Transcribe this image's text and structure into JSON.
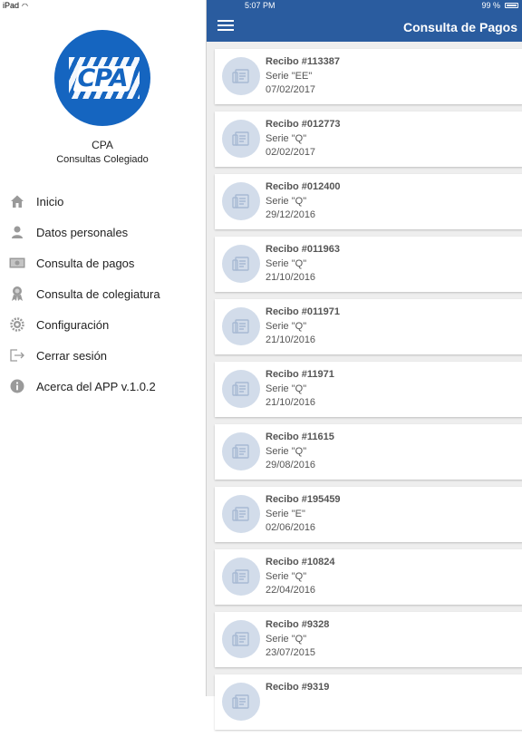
{
  "status": {
    "device": "iPad",
    "time": "5:07 PM",
    "battery": "99 %"
  },
  "sidebar": {
    "org_name": "CPA",
    "org_subtitle": "Consultas Colegiado",
    "logo_text": "CPA",
    "items": [
      {
        "label": "Inicio",
        "icon": "home-icon"
      },
      {
        "label": "Datos personales",
        "icon": "user-icon"
      },
      {
        "label": "Consulta de pagos",
        "icon": "money-icon"
      },
      {
        "label": "Consulta de colegiatura",
        "icon": "award-icon"
      },
      {
        "label": "Configuración",
        "icon": "gear-icon"
      },
      {
        "label": "Cerrar sesión",
        "icon": "logout-icon"
      },
      {
        "label": "Acerca del APP v.1.0.2",
        "icon": "info-icon"
      }
    ]
  },
  "header": {
    "title": "Consulta de Pagos"
  },
  "receipts": [
    {
      "title": "Recibo #113387",
      "serie": "Serie \"EE\"",
      "date": "07/02/2017"
    },
    {
      "title": "Recibo #012773",
      "serie": "Serie \"Q\"",
      "date": "02/02/2017"
    },
    {
      "title": "Recibo #012400",
      "serie": "Serie \"Q\"",
      "date": "29/12/2016"
    },
    {
      "title": "Recibo #011963",
      "serie": "Serie \"Q\"",
      "date": "21/10/2016"
    },
    {
      "title": "Recibo #011971",
      "serie": "Serie \"Q\"",
      "date": "21/10/2016"
    },
    {
      "title": "Recibo #11971",
      "serie": "Serie \"Q\"",
      "date": "21/10/2016"
    },
    {
      "title": "Recibo #11615",
      "serie": "Serie \"Q\"",
      "date": "29/08/2016"
    },
    {
      "title": "Recibo #195459",
      "serie": "Serie \"E\"",
      "date": "02/06/2016"
    },
    {
      "title": "Recibo #10824",
      "serie": "Serie \"Q\"",
      "date": "22/04/2016"
    },
    {
      "title": "Recibo #9328",
      "serie": "Serie \"Q\"",
      "date": "23/07/2015"
    },
    {
      "title": "Recibo #9319",
      "serie": "",
      "date": ""
    }
  ],
  "colors": {
    "header": "#2a5c9f",
    "logo": "#1565c0",
    "avatar": "#d2dcea",
    "icon_gray": "#8a8a8a"
  }
}
